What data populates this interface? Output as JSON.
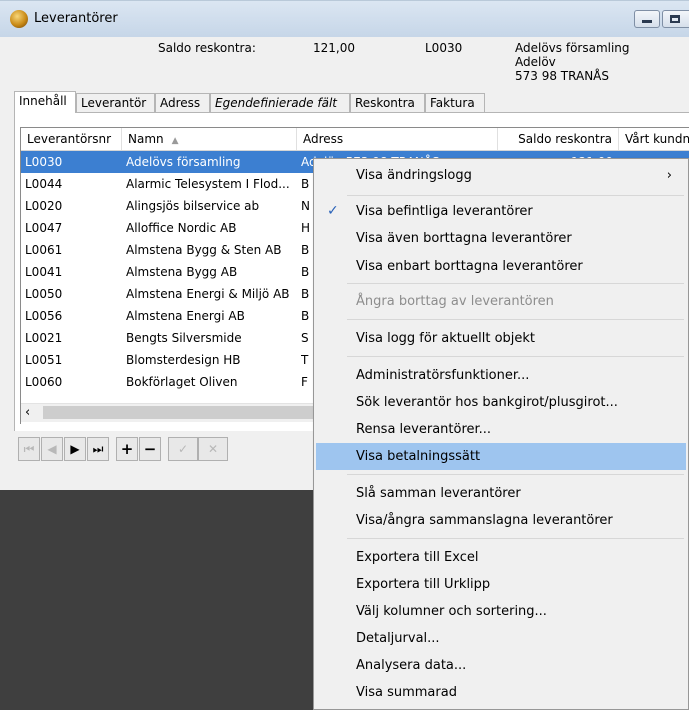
{
  "window": {
    "title": "Leverantörer"
  },
  "header": {
    "saldo_label": "Saldo reskontra:",
    "saldo_value": "121,00",
    "supplier_code": "L0030",
    "address_line1": "Adelövs församling",
    "address_line2": "Adelöv",
    "address_line3": "573 98  TRANÅS"
  },
  "tabs": [
    {
      "label": "Innehåll"
    },
    {
      "label": "Leverantör"
    },
    {
      "label": "Adress"
    },
    {
      "label": "Egendefinierade fält"
    },
    {
      "label": "Reskontra"
    },
    {
      "label": "Faktura"
    }
  ],
  "grid": {
    "columns": [
      {
        "label": "Leverantörsnr"
      },
      {
        "label": "Namn"
      },
      {
        "label": "Adress"
      },
      {
        "label": "Saldo reskontra"
      },
      {
        "label": "Vårt kundnr"
      }
    ],
    "sort_indicator": "▲",
    "rows": [
      {
        "nr": "L0030",
        "name": "Adelövs församling",
        "adress": "Adelöv   573 98  TRANÅS",
        "saldo": "121,00"
      },
      {
        "nr": "L0044",
        "name": "Alarmic Telesystem I Flod...",
        "adress": "B"
      },
      {
        "nr": "L0020",
        "name": "Alingsjös bilservice ab",
        "adress": "N"
      },
      {
        "nr": "L0047",
        "name": "Alloffice Nordic AB",
        "adress": "H"
      },
      {
        "nr": "L0061",
        "name": "Almstena Bygg & Sten AB",
        "adress": "B"
      },
      {
        "nr": "L0041",
        "name": "Almstena Bygg AB",
        "adress": "B"
      },
      {
        "nr": "L0050",
        "name": "Almstena Energi & Miljö AB",
        "adress": "B"
      },
      {
        "nr": "L0056",
        "name": "Almstena Energi AB",
        "adress": "B"
      },
      {
        "nr": "L0021",
        "name": "Bengts Silversmide",
        "adress": "S"
      },
      {
        "nr": "L0051",
        "name": "Blomsterdesign HB",
        "adress": "T"
      },
      {
        "nr": "L0060",
        "name": "Bokförlaget Oliven",
        "adress": "F"
      }
    ]
  },
  "navbar": {
    "first": "⏮",
    "prev": "◀",
    "next": "▶",
    "last": "⏭",
    "add": "+",
    "remove": "−",
    "confirm": "✓",
    "cancel": "✕"
  },
  "context_menu": {
    "items": [
      {
        "label": "Visa ändringslogg",
        "submenu": "›"
      },
      {
        "label": "Visa befintliga leverantörer",
        "checked": "✓"
      },
      {
        "label": "Visa även borttagna leverantörer"
      },
      {
        "label": "Visa enbart borttagna leverantörer"
      },
      {
        "label": "Ångra borttag av leverantören"
      },
      {
        "label": "Visa logg för aktuellt objekt"
      },
      {
        "label": "Administratörsfunktioner..."
      },
      {
        "label": "Sök leverantör hos bankgirot/plusgirot..."
      },
      {
        "label": "Rensa leverantörer..."
      },
      {
        "label": "Visa betalningssätt"
      },
      {
        "label": "Slå samman leverantörer"
      },
      {
        "label": "Visa/ångra sammanslagna leverantörer"
      },
      {
        "label": "Exportera till Excel"
      },
      {
        "label": "Exportera till Urklipp"
      },
      {
        "label": "Välj kolumner och sortering..."
      },
      {
        "label": "Detaljurval..."
      },
      {
        "label": "Analysera data..."
      },
      {
        "label": "Visa summarad"
      }
    ]
  }
}
